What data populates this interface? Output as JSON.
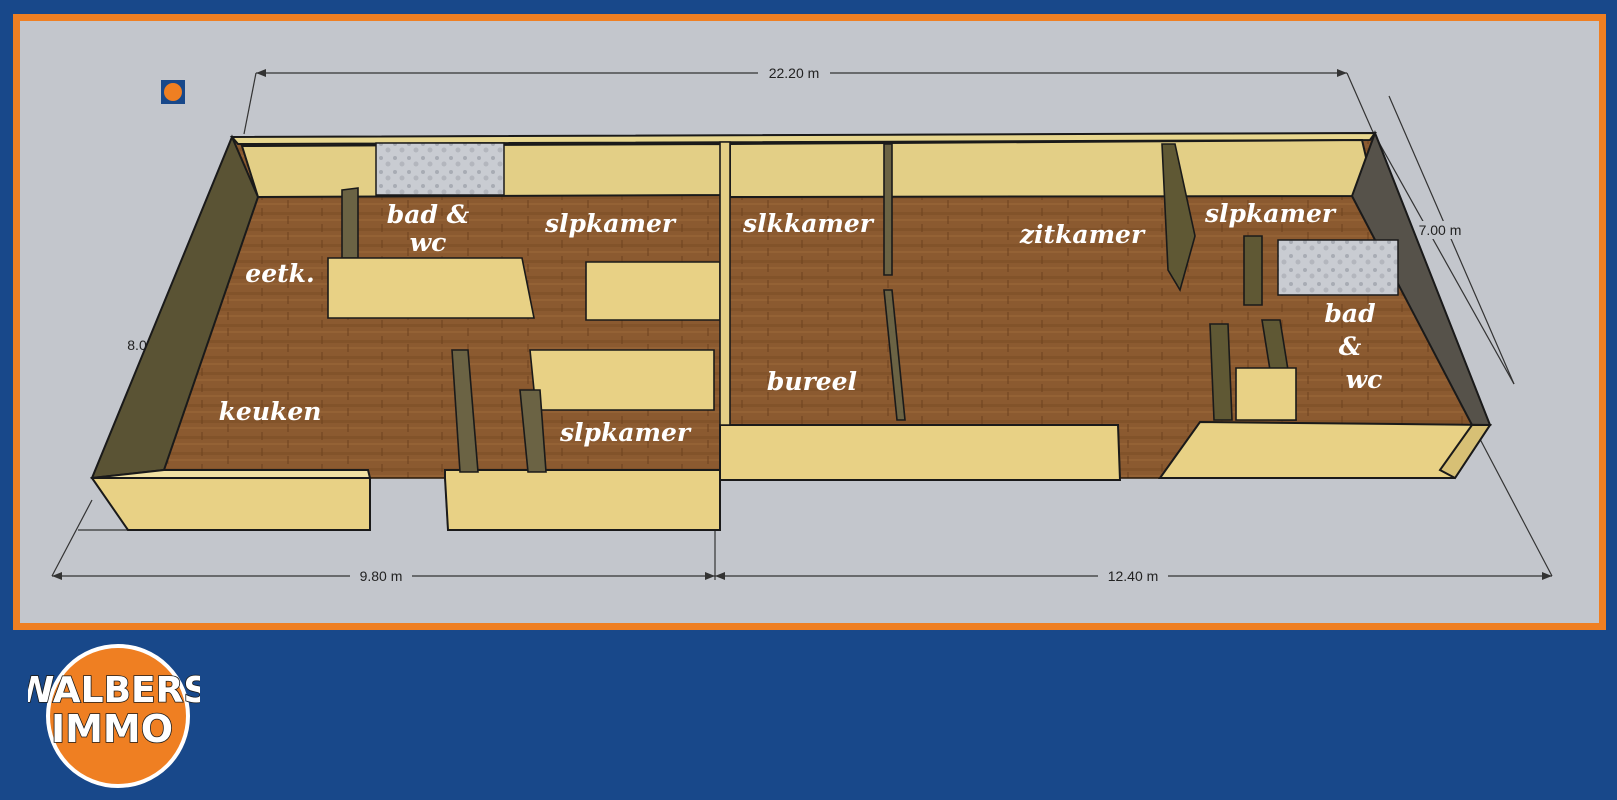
{
  "brand": {
    "line1": "WALBERS",
    "line2": "IMMO",
    "colors": {
      "navy": "#18488a",
      "orange": "#ef7f22",
      "white": "#ffffff"
    }
  },
  "dimensions": {
    "total_length": "22.20 m",
    "width_right": "7.00 m",
    "width_left": "8.0",
    "segment_left": "9.80 m",
    "segment_right": "12.40 m"
  },
  "rooms": {
    "eetk": "eetk.",
    "keuken": "keuken",
    "bad1_line1": "bad &",
    "bad1_line2": "wc",
    "slpkamer1": "slpkamer",
    "slpkamer2": "slpkamer",
    "slkkamer": "slkkamer",
    "bureel": "bureel",
    "zitkamer": "zitkamer",
    "slpkamer3": "slpkamer",
    "bad2_line1": "bad",
    "bad2_line2": "&",
    "bad2_line3": "wc"
  }
}
